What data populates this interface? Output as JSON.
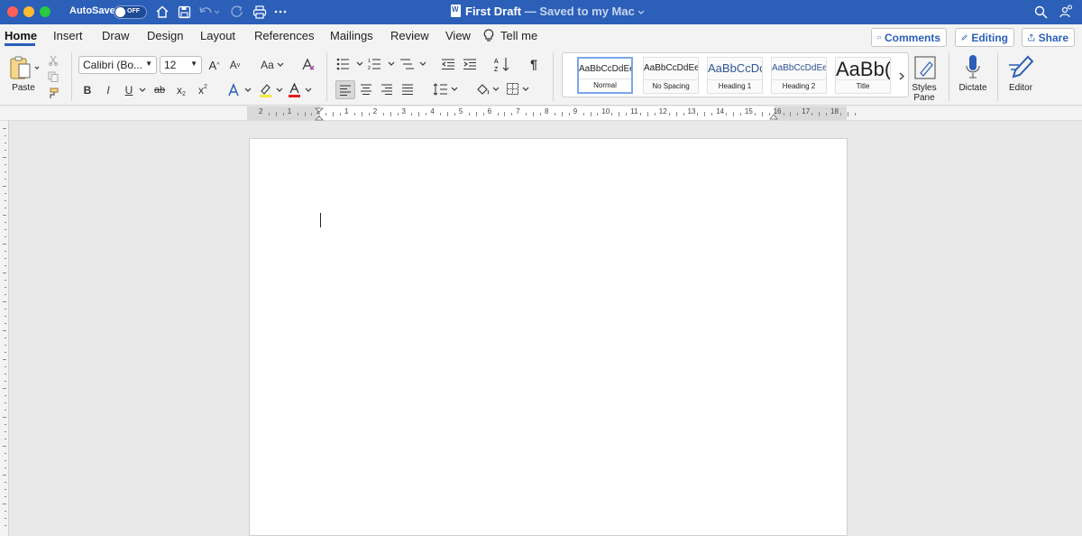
{
  "titlebar": {
    "autosave_label": "AutoSave",
    "autosave_state": "OFF",
    "doc_name": "First Draft",
    "doc_status": "— Saved to my Mac",
    "background_color": "#2b5fb8"
  },
  "tabs": [
    "Home",
    "Insert",
    "Draw",
    "Design",
    "Layout",
    "References",
    "Mailings",
    "Review",
    "View",
    "Tell me"
  ],
  "active_tab": "Home",
  "actions": {
    "comments": "Comments",
    "editing": "Editing",
    "share": "Share"
  },
  "ribbon": {
    "paste_label": "Paste",
    "font_name": "Calibri (Bo...",
    "font_size": "12",
    "change_case": "Aa",
    "bold": "B",
    "italic": "I",
    "underline": "U",
    "strikethrough": "ab",
    "subscript": "x",
    "superscript": "x",
    "styles": [
      {
        "sample": "AaBbCcDdEe",
        "name": "Normal"
      },
      {
        "sample": "AaBbCcDdEe",
        "name": "No Spacing"
      },
      {
        "sample": "AaBbCcDc",
        "name": "Heading 1"
      },
      {
        "sample": "AaBbCcDdEe",
        "name": "Heading 2"
      },
      {
        "sample": "AaBb(",
        "name": "Title"
      }
    ],
    "styles_pane_line1": "Styles",
    "styles_pane_line2": "Pane",
    "dictate_label": "Dictate",
    "editor_label": "Editor",
    "accent_color": "#2b5fb8",
    "font_color": "#e02020",
    "highlight_color": "#f5e642"
  },
  "ruler": {
    "numbers": [
      "2",
      "1",
      "1",
      "1",
      "2",
      "3",
      "4",
      "5",
      "6",
      "7",
      "8",
      "9",
      "10",
      "11",
      "12",
      "13",
      "14",
      "15",
      "16",
      "17",
      "18"
    ]
  }
}
